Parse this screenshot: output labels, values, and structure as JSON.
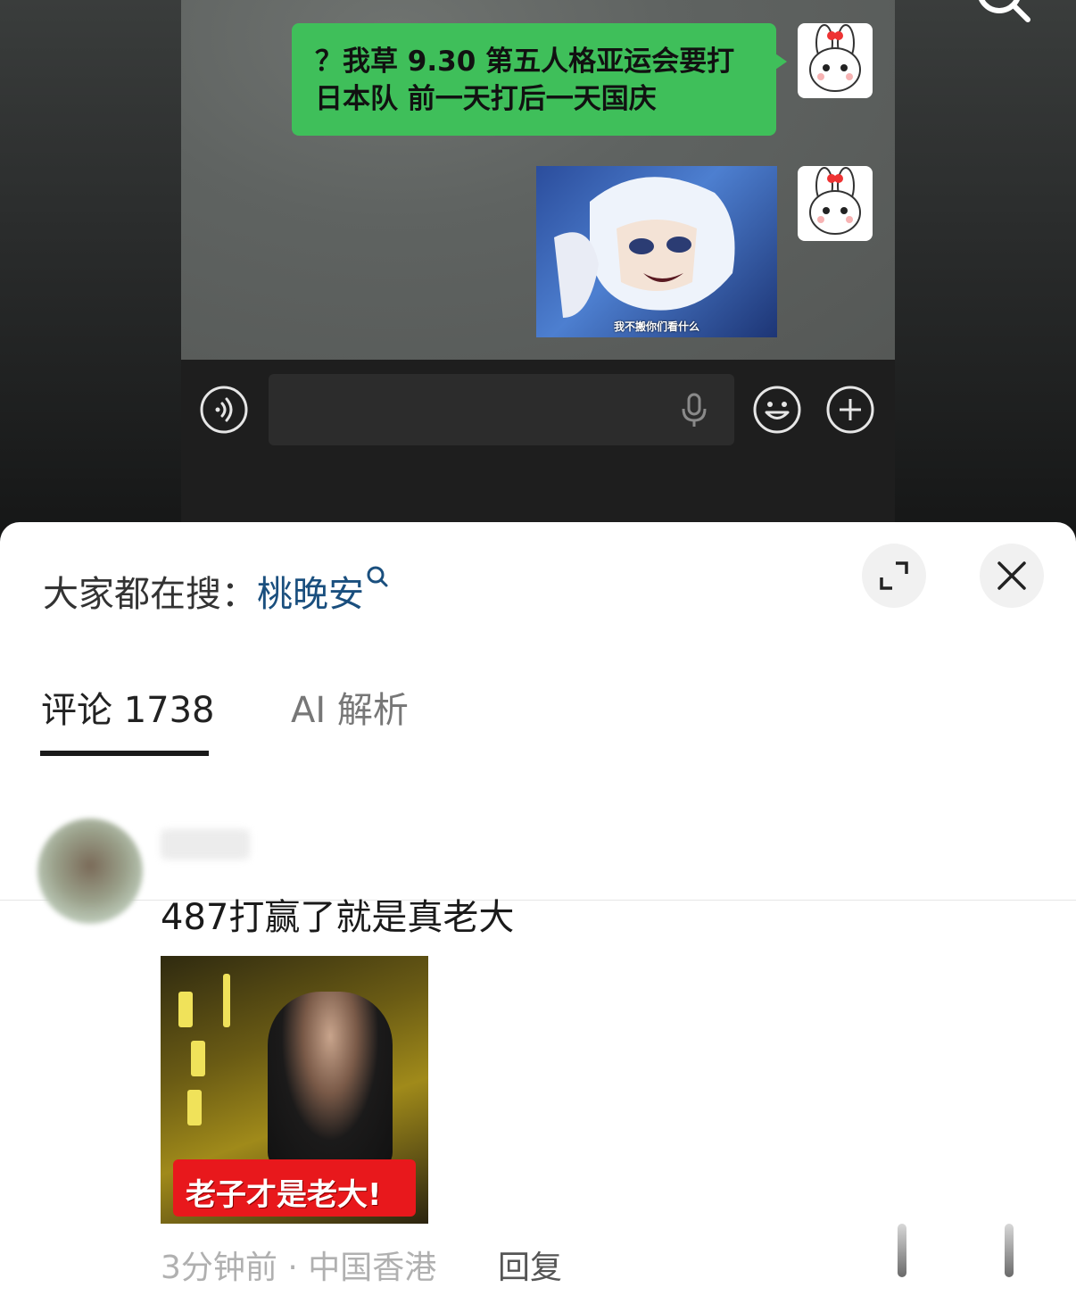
{
  "chat": {
    "message_text": "？我草 9.30 第五人格亚运会要打日本队 前一天打后一天国庆",
    "image_caption": "我不搬你们看什么"
  },
  "sheet": {
    "hot_search_prefix": "大家都在搜：",
    "hot_search_keyword": "桃晚安",
    "tabs": [
      {
        "label": "评论 1738",
        "active": true
      },
      {
        "label": "AI 解析",
        "active": false
      }
    ]
  },
  "comment": {
    "username": "",
    "text": "487打赢了就是真老大",
    "image_caption": "老子才是老大!",
    "meta": "3分钟前 · 中国香港",
    "reply_label": "回复"
  },
  "colors": {
    "bubble_green": "#3fbf5a",
    "keyword_blue": "#1a4f7e",
    "tab_underline": "#1a1a1a"
  }
}
